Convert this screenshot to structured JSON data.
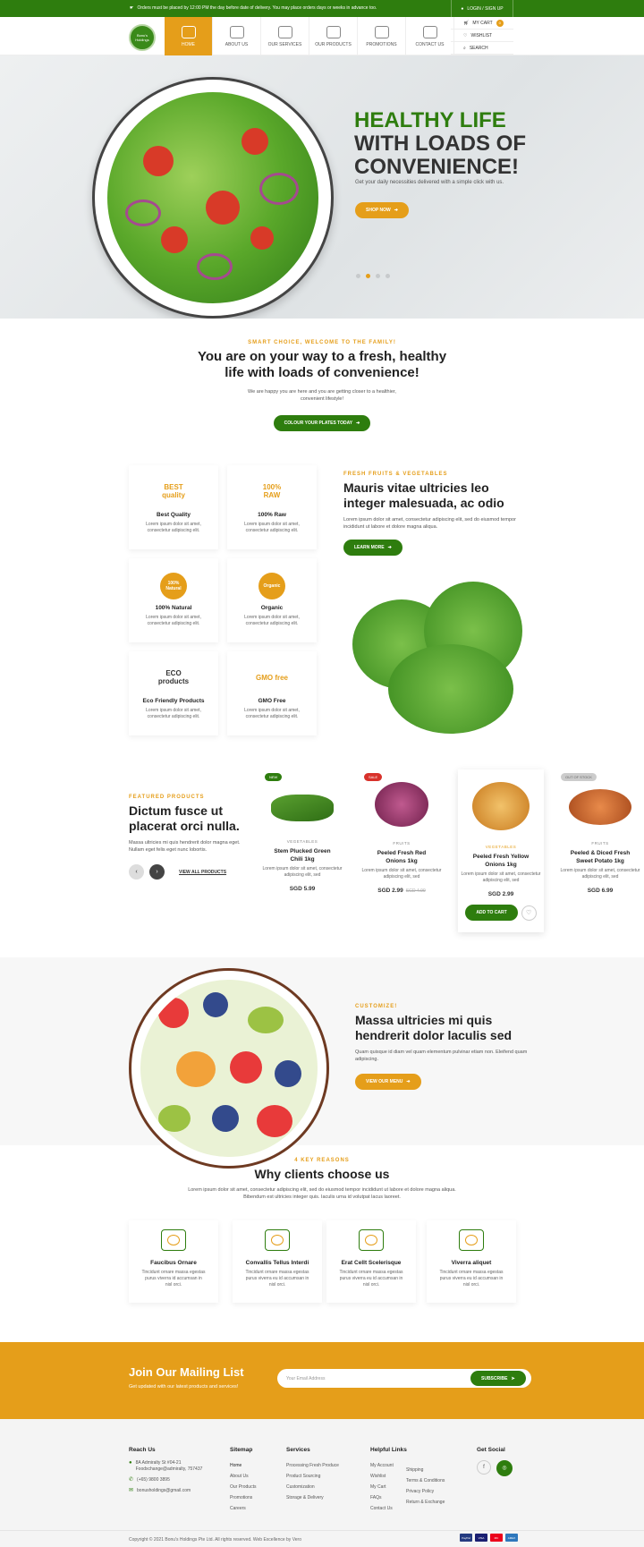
{
  "topbar": {
    "notice": "Orders must be placed by 12:00 PM the day before date of delivery. You may place orders days or weeks in advance too.",
    "login_label": "LOGIN / SIGN UP"
  },
  "nav": {
    "logo_text": "Bonu's Holdings",
    "items": [
      {
        "label": "HOME"
      },
      {
        "label": "ABOUT US"
      },
      {
        "label": "OUR SERVICES"
      },
      {
        "label": "OUR PRODUCTS"
      },
      {
        "label": "PROMOTIONS"
      },
      {
        "label": "CONTACT US"
      }
    ],
    "cart_label": "MY CART",
    "cart_count": "0",
    "wishlist_label": "WISHLIST",
    "search_label": "SEARCH"
  },
  "hero": {
    "title_line1": "HEALTHY LIFE",
    "title_line2": "WITH LOADS OF",
    "title_line3": "CONVENIENCE!",
    "subtitle": "Get your daily necessities delivered with a simple click with us.",
    "cta": "SHOP NOW"
  },
  "welcome": {
    "kicker": "SMART CHOICE, WELCOME TO THE FAMILY!",
    "title": "You are on your way to a fresh, healthy life with loads of convenience!",
    "text": "We are happy you are here and you are getting closer to a healthier, convenient lifestyle!",
    "cta": "COLOUR YOUR PLATES TODAY"
  },
  "features": [
    {
      "badge": "BEST quality",
      "title": "Best Quality",
      "text": "Lorem ipsum dolor sit amet, consectetur adipiscing elit."
    },
    {
      "badge": "100% RAW",
      "title": "100% Raw",
      "text": "Lorem ipsum dolor sit amet, consectetur adipiscing elit."
    },
    {
      "badge": "100% Natural",
      "title": "100% Natural",
      "text": "Lorem ipsum dolor sit amet, consectetur adipiscing elit."
    },
    {
      "badge": "Organic",
      "title": "Organic",
      "text": "Lorem ipsum dolor sit amet, consectetur adipiscing elit."
    },
    {
      "badge": "ECO products",
      "title": "Eco Friendly Products",
      "text": "Lorem ipsum dolor sit amet, consectetur adipiscing elit."
    },
    {
      "badge": "GMO free",
      "title": "GMO Free",
      "text": "Lorem ipsum dolor sit amet, consectetur adipiscing elit."
    }
  ],
  "fresh": {
    "kicker": "FRESH FRUITS & VEGETABLES",
    "title": "Mauris vitae ultricies leo integer malesuada, ac odio",
    "text": "Lorem ipsum dolor sit amet, consectetur adipiscing elit, sed do eiusmod tempor incididunt ut labore et dolore magna aliqua.",
    "cta": "LEARN MORE"
  },
  "featured": {
    "kicker": "FEATURED PRODUCTS",
    "title": "Dictum fusce ut placerat orci nulla.",
    "text": "Massa ultricies mi quis hendrerit dolor magna eget. Nullam eget felis eget nunc lobortis.",
    "link": "VIEW ALL PRODUCTS"
  },
  "products": [
    {
      "tag": "NEW",
      "tag_color": "#2e7d0e",
      "category": "VEGETABLES",
      "name": "Stem Plucked Green Chili 1kg",
      "desc": "Lorem ipsum dolor sit amet, consectetur adipiscing elit, sed",
      "price": "SGD 5.99",
      "old_price": ""
    },
    {
      "tag": "SALE",
      "tag_color": "#d8322b",
      "category": "FRUITS",
      "name": "Peeled Fresh Red Onions 1kg",
      "desc": "Lorem ipsum dolor sit amet, consectetur adipiscing elit, sed",
      "price": "SGD 2.99",
      "old_price": "SGD 4.99"
    },
    {
      "tag": "",
      "tag_color": "",
      "category": "VEGETABLES",
      "name": "Peeled Fresh Yellow Onions 1kg",
      "desc": "Lorem ipsum dolor sit amet, consectetur adipiscing elit, sed",
      "price": "SGD 2.99",
      "old_price": "",
      "cta": "ADD TO CART"
    },
    {
      "tag": "OUT OF STOCK",
      "tag_color": "#bbbbbb",
      "category": "FRUITS",
      "name": "Peeled & Diced Fresh Sweet Potato 1kg",
      "desc": "Lorem ipsum dolor sit amet, consectetur adipiscing elit, sed",
      "price": "SGD 6.99",
      "old_price": ""
    }
  ],
  "customize": {
    "kicker": "CUSTOMIZE!",
    "title": "Massa ultricies mi quis hendrerit dolor laculis sed",
    "text": "Quam quisque id diam vel quam elementum pulvinar etiam non. Eleifend quam adipiscing.",
    "cta": "VIEW OUR MENU"
  },
  "reasons": {
    "kicker": "4 KEY REASONS",
    "title": "Why clients choose us",
    "intro": "Lorem ipsum dolor sit amet, consectetur adipiscing elit, sed do eiusmod tempor incididunt ut labore et dolore magna aliqua. Bibendum est ultricies integer quis. Iaculis urna id volutpat lacus laoreet.",
    "items": [
      {
        "title": "Faucibus Ornare",
        "text": "Tincidunt ornare massa egestas purus viverra id accumsan in nisl orci."
      },
      {
        "title": "Convallis Tellus Interdi",
        "text": "Tincidunt ornare massa egestas purus viverra eu id accumsan in nisl orci."
      },
      {
        "title": "Erat Cellt Scelerisque",
        "text": "Tincidunt ornare massa egestas purus viverra eu id accumsan in nisl orci."
      },
      {
        "title": "Viverra aliquet",
        "text": "Tincidunt ornare massa egestas purus viverra eu id accumsan in nisl orci."
      }
    ]
  },
  "mailing": {
    "title": "Join Our Mailing List",
    "subtitle": "Get updated with our latest products and services!",
    "placeholder": "Your Email Address",
    "cta": "SUBSCRIBE"
  },
  "footer": {
    "reach": {
      "title": "Reach Us",
      "address": "8A Admiralty St #04-21 Foodxchange@admiralty, 757437",
      "phone": "(+65) 9800 3895",
      "email": "bonusholdings@gmail.com"
    },
    "sitemap": {
      "title": "Sitemap",
      "links": [
        "Home",
        "About Us",
        "Our Products",
        "Promotions",
        "Careers"
      ]
    },
    "services": {
      "title": "Services",
      "links": [
        "Processing Fresh Produce",
        "Product Sourcing",
        "Customization",
        "Storage & Delivery"
      ]
    },
    "helpful": {
      "title": "Helpful Links",
      "col1": [
        "My Account",
        "Wishlist",
        "My Cart",
        "FAQs",
        "Contact Us"
      ],
      "col2": [
        "Shipping",
        "Terms & Conditions",
        "Privacy Policy",
        "Return & Exchange"
      ]
    },
    "social": {
      "title": "Get Social"
    },
    "copyright": "Copyright © 2021 Bonu's Holdings Pte Ltd. All rights reserved. Web Excellence by Vero",
    "payments": [
      "PayPal",
      "VISA",
      "MC",
      "AMEX"
    ]
  }
}
